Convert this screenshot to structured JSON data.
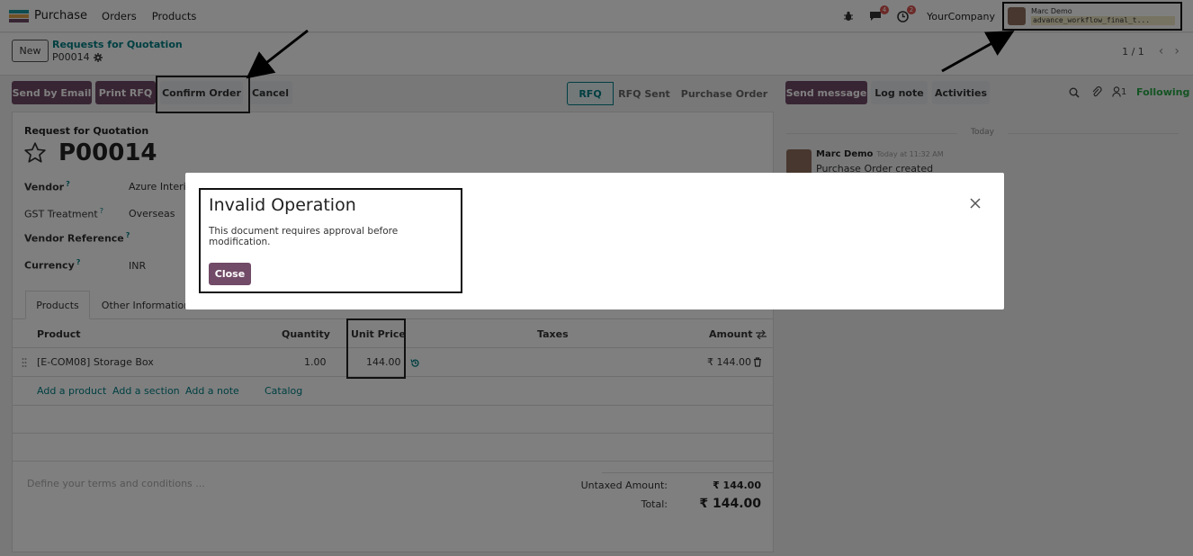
{
  "navbar": {
    "app_name": "Purchase",
    "menu": [
      "Orders",
      "Products"
    ],
    "chat_badge": "4",
    "activity_badge": "2",
    "company": "YourCompany",
    "user_name": "Marc Demo",
    "db_name": "advance_workflow_final_t..."
  },
  "control": {
    "new_label": "New",
    "breadcrumb": "Requests for Quotation",
    "record_id": "P00014",
    "pager": "1 / 1"
  },
  "statusbar": {
    "send_email": "Send by Email",
    "print_rfq": "Print RFQ",
    "confirm_order": "Confirm Order",
    "cancel": "Cancel",
    "stages": [
      "RFQ",
      "RFQ Sent",
      "Purchase Order"
    ]
  },
  "chatter_actions": {
    "send_message": "Send message",
    "log_note": "Log note",
    "activities": "Activities",
    "following": "Following",
    "follower_count": "1"
  },
  "form": {
    "caption": "Request for Quotation",
    "title": "P00014",
    "fields": {
      "vendor_label": "Vendor",
      "vendor_value": "Azure Interio",
      "gst_label": "GST Treatment",
      "gst_value": "Overseas",
      "vendor_ref_label": "Vendor Reference",
      "currency_label": "Currency",
      "currency_value": "INR"
    },
    "tabs": [
      "Products",
      "Other Information"
    ],
    "table": {
      "headers": {
        "product": "Product",
        "quantity": "Quantity",
        "unit_price": "Unit Price",
        "taxes": "Taxes",
        "amount": "Amount"
      },
      "rows": [
        {
          "product": "[E-COM08] Storage Box",
          "quantity": "1.00",
          "unit_price": "144.00",
          "amount": "₹ 144.00"
        }
      ]
    },
    "add_links": [
      "Add a product",
      "Add a section",
      "Add a note",
      "Catalog"
    ],
    "terms_placeholder": "Define your terms and conditions ...",
    "untaxed_label": "Untaxed Amount:",
    "untaxed_value": "₹ 144.00",
    "total_label": "Total:",
    "total_value": "₹ 144.00"
  },
  "chatter": {
    "day": "Today",
    "author": "Marc Demo",
    "time": "Today at 11:32 AM",
    "message": "Purchase Order created"
  },
  "modal": {
    "title": "Invalid Operation",
    "text": "This document requires approval before modification.",
    "close_label": "Close"
  },
  "colors": {
    "brand": "#714b67",
    "accent": "#017e84",
    "overlay": "rgba(0,0,0,0.5)"
  }
}
